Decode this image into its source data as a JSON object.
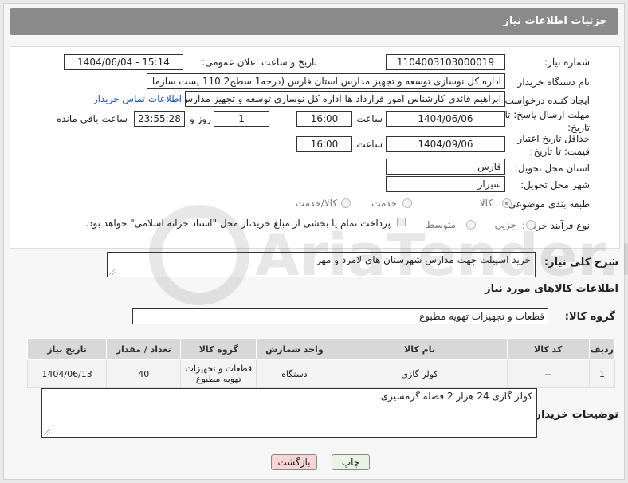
{
  "header": {
    "title": "جزئیات اطلاعات نیاز"
  },
  "form": {
    "need_number_label": "شماره نیاز:",
    "need_number": "1104003103000019",
    "announce_label": "تاریخ و ساعت اعلان عمومی:",
    "announce_value": "1404/06/04 - 15:14",
    "buyer_org_label": "نام دستگاه خریدار:",
    "buyer_org": "اداره کل نوسازی   توسعه و تجهیز مدارس استان فارس (درجه1  سطح2  110 پست سازما",
    "creator_label": "ایجاد کننده درخواست:",
    "creator": "ابراهیم قائدی کارشناس امور قرارداد ها اداره کل نوسازی   توسعه و تجهیز مدارس",
    "contact_link": "اطلاعات تماس خریدار",
    "deadline_label": "مهلت ارسال پاسخ: تا تاریخ:",
    "deadline_date": "1404/06/06",
    "time_label": "ساعت",
    "deadline_time": "16:00",
    "days_value": "1",
    "days_label": "روز و",
    "remaining_time": "23:55:28",
    "remaining_label": "ساعت باقی مانده",
    "validity_label": "حداقل تاریخ اعتبار قیمت: تا تاریخ:",
    "validity_date": "1404/09/06",
    "validity_time": "16:00",
    "province_label": "استان محل تحویل:",
    "province": "فارس",
    "city_label": "شهر محل تحویل:",
    "city": "شیراز",
    "category_label": "طبقه بندی موضوعی:",
    "category_options": [
      "کالا",
      "خدمت",
      "کالا/خدمت"
    ],
    "category_selected": "کالا",
    "process_label": "نوع فرآیند خرید :",
    "process_options": [
      "جزیی",
      "متوسط"
    ],
    "payment_note": "پرداخت تمام یا بخشی از مبلغ خرید،از محل \"اسناد خزانه اسلامی\" خواهد بود."
  },
  "description": {
    "label": "شرح کلی نیاز:",
    "text": "خرید اسپیلت جهت مدارس شهرستان های لامرد و مهر"
  },
  "goods": {
    "section_title": "اطلاعات کالاهای مورد نیاز",
    "group_label": "گروه کالا:",
    "group_value": "قطعات و تجهیزات تهویه مطبوع",
    "columns": [
      "ردیف",
      "کد کالا",
      "نام کالا",
      "واحد شمارش",
      "گروه کالا",
      "تعداد / مقدار",
      "تاریخ نیاز"
    ],
    "rows": [
      {
        "row": "1",
        "code": "--",
        "name": "کولر گازی",
        "unit": "دستگاه",
        "group": "قطعات و تجهیزات تهویه مطبوع",
        "qty": "40",
        "date": "1404/06/13"
      }
    ]
  },
  "buyer_notes": {
    "label": "توضیحات خریدار:",
    "text": "کولر گازی 24 هزار 2 فصله گرمسیری"
  },
  "buttons": {
    "print": "چاپ",
    "back": "بازگشت"
  },
  "watermark": {
    "text": "AriaTender.net"
  },
  "colors": {
    "header_bg": "#8a8a8a",
    "link": "#1a55c8",
    "back_button": "#f7d5d5",
    "print_button": "#e9f3e4"
  }
}
